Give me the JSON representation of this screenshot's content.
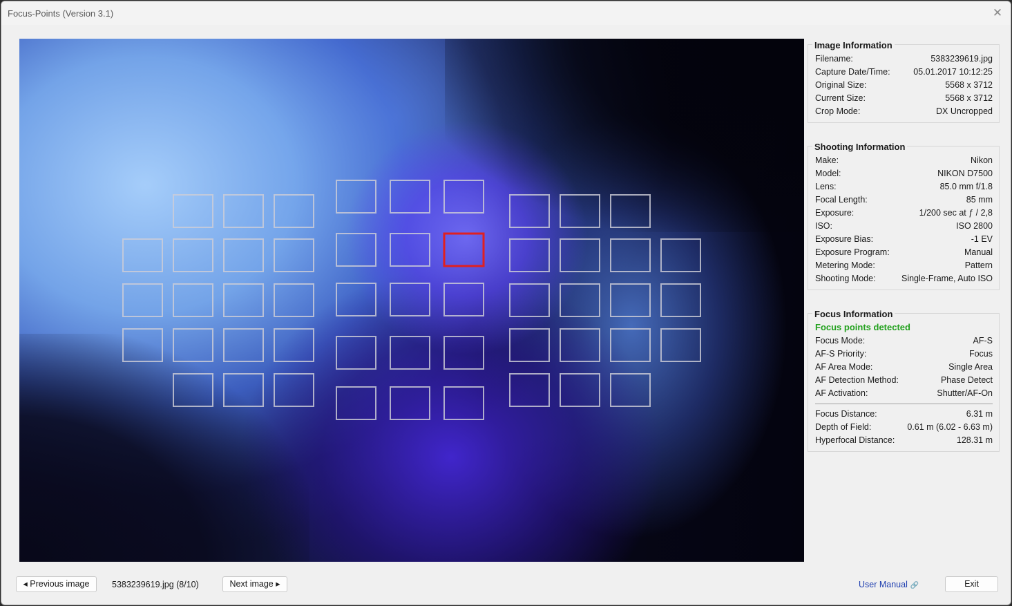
{
  "window": {
    "title": "Focus-Points (Version 3.1)"
  },
  "image_info": {
    "title": "Image Information",
    "rows": [
      {
        "label": "Filename:",
        "value": "5383239619.jpg"
      },
      {
        "label": "Capture Date/Time:",
        "value": "05.01.2017 10:12:25"
      },
      {
        "label": "Original Size:",
        "value": "5568 x 3712"
      },
      {
        "label": "Current Size:",
        "value": "5568 x 3712"
      },
      {
        "label": "Crop Mode:",
        "value": "DX Uncropped"
      }
    ]
  },
  "shooting_info": {
    "title": "Shooting Information",
    "rows": [
      {
        "label": "Make:",
        "value": "Nikon"
      },
      {
        "label": "Model:",
        "value": "NIKON D7500"
      },
      {
        "label": "Lens:",
        "value": "85.0 mm f/1.8"
      },
      {
        "label": "Focal Length:",
        "value": "85 mm"
      },
      {
        "label": "Exposure:",
        "value": "1/200 sec at ƒ / 2,8"
      },
      {
        "label": "ISO:",
        "value": "ISO 2800"
      },
      {
        "label": "Exposure Bias:",
        "value": "-1 EV"
      },
      {
        "label": "Exposure Program:",
        "value": "Manual"
      },
      {
        "label": "Metering Mode:",
        "value": "Pattern"
      },
      {
        "label": "Shooting Mode:",
        "value": "Single-Frame, Auto ISO"
      }
    ]
  },
  "focus_info": {
    "title": "Focus Information",
    "status": "Focus points detected",
    "status_color": "#23a11e",
    "rows": [
      {
        "label": "Focus Mode:",
        "value": "AF-S"
      },
      {
        "label": "AF-S Priority:",
        "value": "Focus"
      },
      {
        "label": "AF Area Mode:",
        "value": "Single Area"
      },
      {
        "label": "AF Detection Method:",
        "value": "Phase Detect"
      },
      {
        "label": "AF Activation:",
        "value": "Shutter/AF-On"
      }
    ],
    "distance_rows": [
      {
        "label": "Focus Distance:",
        "value": "6.31 m"
      },
      {
        "label": "Depth of Field:",
        "value": "0.61 m (6.02 - 6.63 m)"
      },
      {
        "label": "Hyperfocal Distance:",
        "value": "128.31 m"
      }
    ]
  },
  "af_overlay": {
    "active_color": "#e02020",
    "inactive_color": "#cdcdd7"
  },
  "bottom": {
    "prev_label": "◂ Previous image",
    "file_label": "5383239619.jpg (8/10)",
    "next_label": "Next image ▸",
    "manual_label": "User Manual",
    "exit_label": "Exit"
  }
}
